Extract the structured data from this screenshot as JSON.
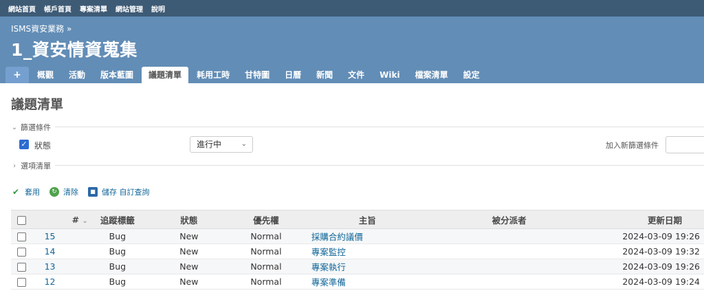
{
  "top_menu": [
    "網站首頁",
    "帳戶首頁",
    "專案清單",
    "網站管理",
    "說明"
  ],
  "header": {
    "breadcrumb": "ISMS資安業務 »",
    "project_title": "1_資安情資蒐集"
  },
  "main_menu": {
    "add_label": "+",
    "tabs": [
      "概觀",
      "活動",
      "版本藍圖",
      "議題清單",
      "耗用工時",
      "甘特圖",
      "日曆",
      "新聞",
      "文件",
      "Wiki",
      "檔案清單",
      "設定"
    ],
    "selected": "議題清單"
  },
  "page": {
    "title": "議題清單",
    "filters_legend": "篩選條件",
    "status_label": "狀態",
    "status_value": "進行中",
    "add_filter_label": "加入新篩選條件",
    "options_legend": "選項清單"
  },
  "actions": {
    "apply": "套用",
    "clear": "清除",
    "save": "儲存 自訂查詢"
  },
  "table": {
    "headers": {
      "id": "#",
      "tracker": "追蹤標籤",
      "status": "狀態",
      "priority": "優先權",
      "subject": "主旨",
      "assigned_to": "被分派者",
      "updated_on": "更新日期"
    },
    "rows": [
      {
        "id": "15",
        "tracker": "Bug",
        "status": "New",
        "priority": "Normal",
        "subject": "採購合約議價",
        "assigned_to": "",
        "updated_on": "2024-03-09 19:26"
      },
      {
        "id": "14",
        "tracker": "Bug",
        "status": "New",
        "priority": "Normal",
        "subject": "專案監控",
        "assigned_to": "",
        "updated_on": "2024-03-09 19:32"
      },
      {
        "id": "13",
        "tracker": "Bug",
        "status": "New",
        "priority": "Normal",
        "subject": "專案執行",
        "assigned_to": "",
        "updated_on": "2024-03-09 19:26"
      },
      {
        "id": "12",
        "tracker": "Bug",
        "status": "New",
        "priority": "Normal",
        "subject": "專案準備",
        "assigned_to": "",
        "updated_on": "2024-03-09 19:24"
      }
    ]
  },
  "colors": {
    "top_bar": "#3e5b76",
    "header": "#628db6",
    "link": "#116699"
  }
}
